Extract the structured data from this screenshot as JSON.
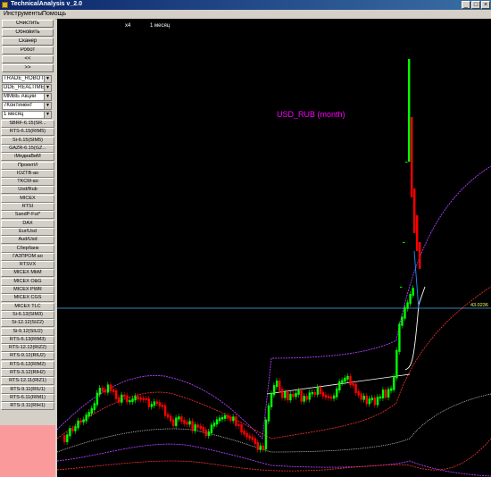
{
  "window": {
    "title": "TechnicalAnalysis v_2.0"
  },
  "menu": [
    "Инструменты",
    "Помощь"
  ],
  "toolbar": {
    "buttons": [
      "Очистить",
      "Обновить",
      "Сканер",
      "Робот",
      "<<",
      ">>"
    ]
  },
  "selectors": [
    "TRADE_ROBOT",
    "DDE_REALTIME",
    "ММВБ Акции",
    "7Континент",
    "1 месяц"
  ],
  "instruments": [
    "SBRF-6.15(SR...",
    "RTS-6.15(RIM5)",
    "Si-6.15(SIM5)",
    "GAZR-6.15(GZ...",
    "iМедиаВиМ",
    "ПроектИ",
    "IOZTB-ao",
    "TKCM-ao",
    "Usd/Rub",
    "MICEX",
    "RTSI",
    "SandP-Fut*",
    "DAX",
    "Eur/Usd",
    "Aud/Usd",
    "Сбербанк",
    "ГАЗПРОМ ао",
    "RTSVX",
    "MICEX MbM",
    "MICEX O&G",
    "MICEX PWR",
    "MICEX CGS",
    "MICEX TLC",
    "Si-6.13(SIM3)",
    "Si-12.12(SIZ2)",
    "Si-9.12(SIU2)",
    "RTS-6.13(RIM3)",
    "RTS-12.12(RIZ2)",
    "RTS-9.12(RIU2)",
    "RTS-6.12(RIM2)",
    "RTS-3.12(RIH2)",
    "RTS-12.11(RIZ1)",
    "RTS-9.11(RIU1)",
    "RTS-6.11(RIM1)",
    "RTS-3.11(RIH1)"
  ],
  "chart": {
    "zoom_label": "x4",
    "period_label": "1 месяц",
    "series_label": "USD_RUB (month)",
    "price_label": "43.0236",
    "colors": {
      "up": "#00ff00",
      "down": "#ff0000",
      "label": "#ff00ff",
      "price_line": "#1e90ff"
    }
  }
}
